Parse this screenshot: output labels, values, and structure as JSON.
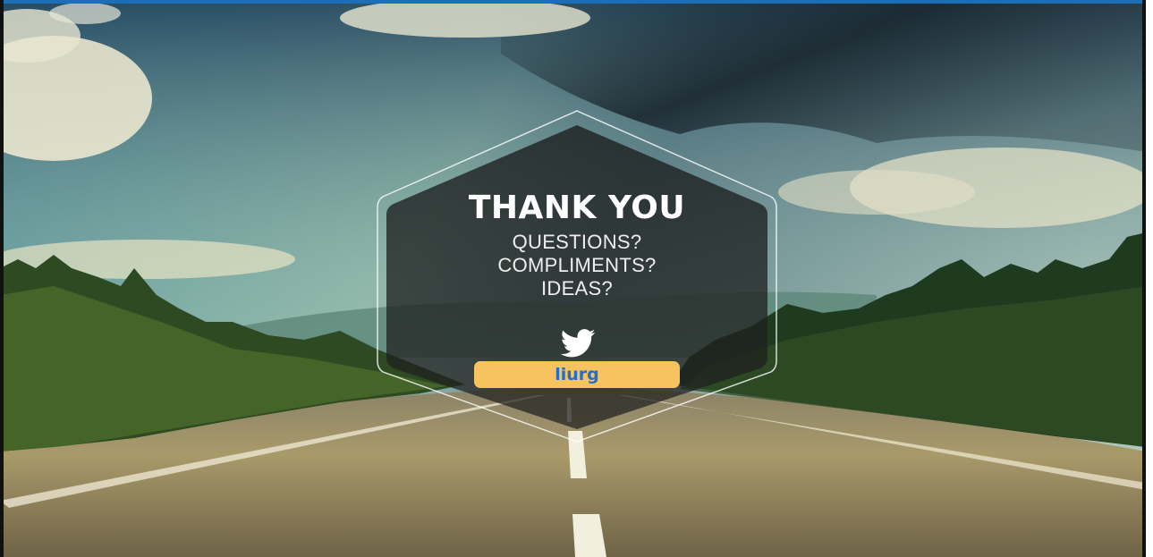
{
  "slide": {
    "title": "THANK YOU",
    "lines": [
      "QUESTIONS?",
      "COMPLIMENTS?",
      "IDEAS?"
    ],
    "icon": "twitter-bird-icon",
    "handle": "liurg"
  },
  "colors": {
    "accent_bar": "#1a6fb8",
    "handle_bg": "#f7c35e",
    "handle_text": "#1f6fd0"
  }
}
